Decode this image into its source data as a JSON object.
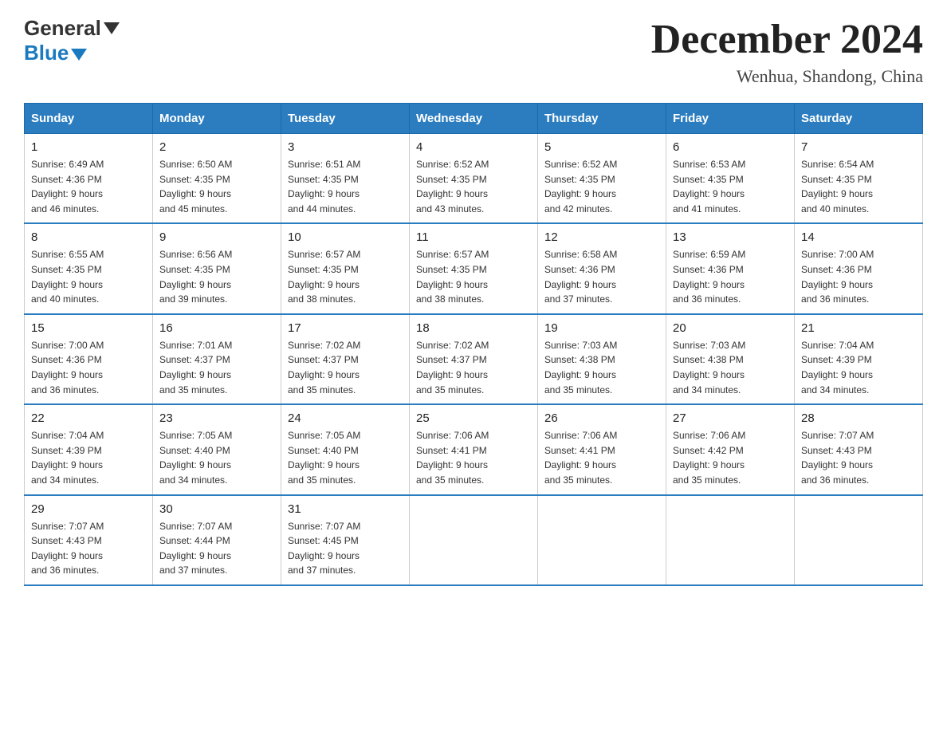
{
  "header": {
    "logo_top": "General",
    "logo_bottom": "Blue",
    "month_title": "December 2024",
    "location": "Wenhua, Shandong, China"
  },
  "days_of_week": [
    "Sunday",
    "Monday",
    "Tuesday",
    "Wednesday",
    "Thursday",
    "Friday",
    "Saturday"
  ],
  "weeks": [
    [
      {
        "day": "1",
        "sunrise": "6:49 AM",
        "sunset": "4:36 PM",
        "daylight": "9 hours and 46 minutes."
      },
      {
        "day": "2",
        "sunrise": "6:50 AM",
        "sunset": "4:35 PM",
        "daylight": "9 hours and 45 minutes."
      },
      {
        "day": "3",
        "sunrise": "6:51 AM",
        "sunset": "4:35 PM",
        "daylight": "9 hours and 44 minutes."
      },
      {
        "day": "4",
        "sunrise": "6:52 AM",
        "sunset": "4:35 PM",
        "daylight": "9 hours and 43 minutes."
      },
      {
        "day": "5",
        "sunrise": "6:52 AM",
        "sunset": "4:35 PM",
        "daylight": "9 hours and 42 minutes."
      },
      {
        "day": "6",
        "sunrise": "6:53 AM",
        "sunset": "4:35 PM",
        "daylight": "9 hours and 41 minutes."
      },
      {
        "day": "7",
        "sunrise": "6:54 AM",
        "sunset": "4:35 PM",
        "daylight": "9 hours and 40 minutes."
      }
    ],
    [
      {
        "day": "8",
        "sunrise": "6:55 AM",
        "sunset": "4:35 PM",
        "daylight": "9 hours and 40 minutes."
      },
      {
        "day": "9",
        "sunrise": "6:56 AM",
        "sunset": "4:35 PM",
        "daylight": "9 hours and 39 minutes."
      },
      {
        "day": "10",
        "sunrise": "6:57 AM",
        "sunset": "4:35 PM",
        "daylight": "9 hours and 38 minutes."
      },
      {
        "day": "11",
        "sunrise": "6:57 AM",
        "sunset": "4:35 PM",
        "daylight": "9 hours and 38 minutes."
      },
      {
        "day": "12",
        "sunrise": "6:58 AM",
        "sunset": "4:36 PM",
        "daylight": "9 hours and 37 minutes."
      },
      {
        "day": "13",
        "sunrise": "6:59 AM",
        "sunset": "4:36 PM",
        "daylight": "9 hours and 36 minutes."
      },
      {
        "day": "14",
        "sunrise": "7:00 AM",
        "sunset": "4:36 PM",
        "daylight": "9 hours and 36 minutes."
      }
    ],
    [
      {
        "day": "15",
        "sunrise": "7:00 AM",
        "sunset": "4:36 PM",
        "daylight": "9 hours and 36 minutes."
      },
      {
        "day": "16",
        "sunrise": "7:01 AM",
        "sunset": "4:37 PM",
        "daylight": "9 hours and 35 minutes."
      },
      {
        "day": "17",
        "sunrise": "7:02 AM",
        "sunset": "4:37 PM",
        "daylight": "9 hours and 35 minutes."
      },
      {
        "day": "18",
        "sunrise": "7:02 AM",
        "sunset": "4:37 PM",
        "daylight": "9 hours and 35 minutes."
      },
      {
        "day": "19",
        "sunrise": "7:03 AM",
        "sunset": "4:38 PM",
        "daylight": "9 hours and 35 minutes."
      },
      {
        "day": "20",
        "sunrise": "7:03 AM",
        "sunset": "4:38 PM",
        "daylight": "9 hours and 34 minutes."
      },
      {
        "day": "21",
        "sunrise": "7:04 AM",
        "sunset": "4:39 PM",
        "daylight": "9 hours and 34 minutes."
      }
    ],
    [
      {
        "day": "22",
        "sunrise": "7:04 AM",
        "sunset": "4:39 PM",
        "daylight": "9 hours and 34 minutes."
      },
      {
        "day": "23",
        "sunrise": "7:05 AM",
        "sunset": "4:40 PM",
        "daylight": "9 hours and 34 minutes."
      },
      {
        "day": "24",
        "sunrise": "7:05 AM",
        "sunset": "4:40 PM",
        "daylight": "9 hours and 35 minutes."
      },
      {
        "day": "25",
        "sunrise": "7:06 AM",
        "sunset": "4:41 PM",
        "daylight": "9 hours and 35 minutes."
      },
      {
        "day": "26",
        "sunrise": "7:06 AM",
        "sunset": "4:41 PM",
        "daylight": "9 hours and 35 minutes."
      },
      {
        "day": "27",
        "sunrise": "7:06 AM",
        "sunset": "4:42 PM",
        "daylight": "9 hours and 35 minutes."
      },
      {
        "day": "28",
        "sunrise": "7:07 AM",
        "sunset": "4:43 PM",
        "daylight": "9 hours and 36 minutes."
      }
    ],
    [
      {
        "day": "29",
        "sunrise": "7:07 AM",
        "sunset": "4:43 PM",
        "daylight": "9 hours and 36 minutes."
      },
      {
        "day": "30",
        "sunrise": "7:07 AM",
        "sunset": "4:44 PM",
        "daylight": "9 hours and 37 minutes."
      },
      {
        "day": "31",
        "sunrise": "7:07 AM",
        "sunset": "4:45 PM",
        "daylight": "9 hours and 37 minutes."
      },
      null,
      null,
      null,
      null
    ]
  ],
  "labels": {
    "sunrise_prefix": "Sunrise: ",
    "sunset_prefix": "Sunset: ",
    "daylight_prefix": "Daylight: "
  }
}
